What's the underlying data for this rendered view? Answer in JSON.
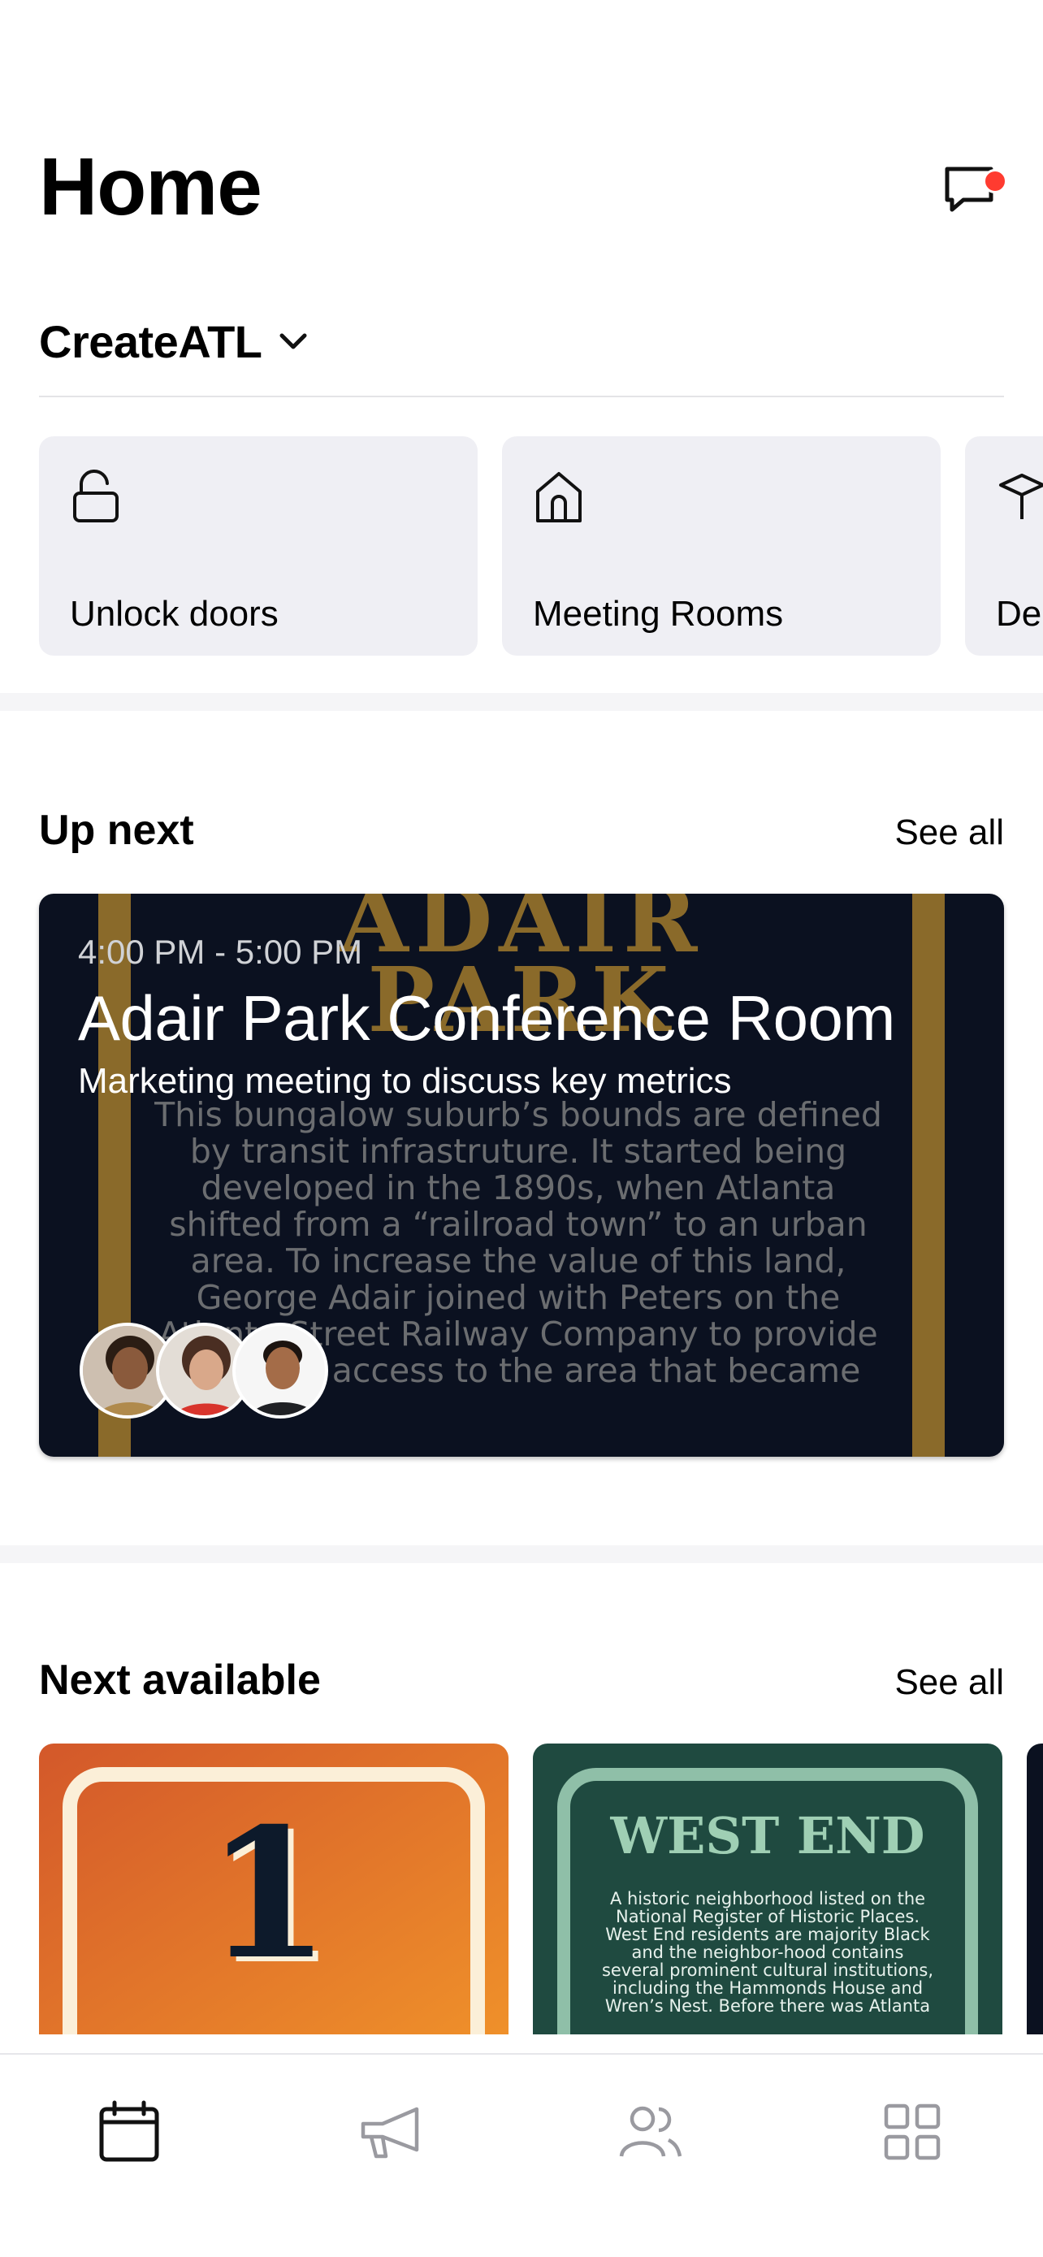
{
  "header": {
    "title": "Home"
  },
  "workspace": {
    "name": "CreateATL"
  },
  "quick_actions": [
    {
      "label": "Unlock doors",
      "icon": "unlock-icon"
    },
    {
      "label": "Meeting Rooms",
      "icon": "home-icon"
    },
    {
      "label": "De",
      "icon": "box-icon"
    }
  ],
  "up_next": {
    "title": "Up next",
    "see_all": "See all",
    "event": {
      "time": "4:00 PM - 5:00 PM",
      "room": "Adair Park Conference Room",
      "description": "Marketing meeting to discuss key metrics",
      "image_title_line1": "ADAIR",
      "image_title_line2": "PARK",
      "image_text": "This bungalow suburb’s bounds are defined by transit infrastruture. It started being developed in the 1890s, when Atlanta shifted from a “railroad town” to an urban area. To increase the value of this land, George Adair joined with Peters on the Atlanta Street Railway Company to provide horsecar access to the area that became"
    }
  },
  "next_available": {
    "title": "Next available",
    "see_all": "See all",
    "rooms": [
      {
        "image_label": "1"
      },
      {
        "image_title": "WEST END",
        "image_text": "A historic neighborhood listed on the National Register of Historic Places. West End residents are majority Black and the neighbor-hood contains several prominent cultural institutions, including the Hammonds House and Wren’s Nest. Before there was Atlanta"
      }
    ]
  },
  "tabbar": {
    "items": [
      {
        "icon": "calendar-icon",
        "active": true
      },
      {
        "icon": "megaphone-icon",
        "active": false
      },
      {
        "icon": "people-icon",
        "active": false
      },
      {
        "icon": "grid-icon",
        "active": false
      }
    ]
  },
  "colors": {
    "accent_red": "#ff3b30",
    "card_bg": "#efeff4",
    "event_bg": "#0b1120",
    "event_gold": "#8a6a2a",
    "room1_orange": "#e9842a",
    "room2_green": "#1f4a40"
  }
}
